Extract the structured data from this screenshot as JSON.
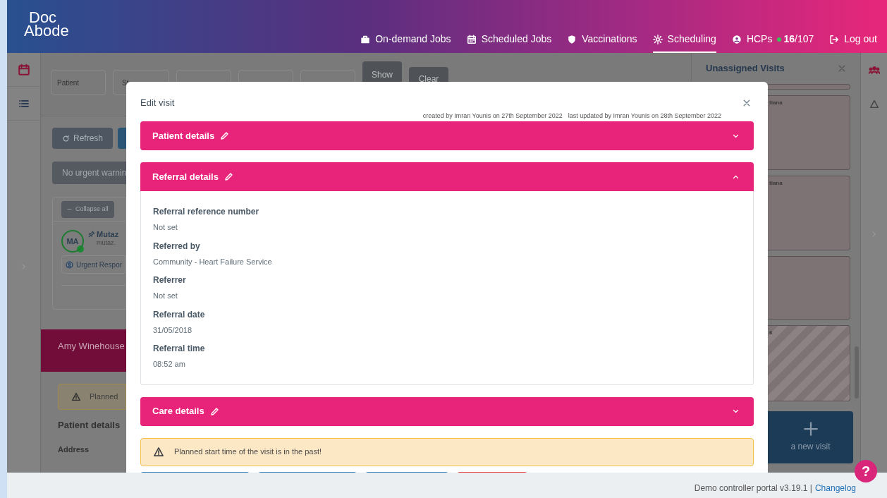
{
  "header": {
    "logo": [
      "Doc",
      "Abode"
    ],
    "nav": [
      {
        "kind": "link",
        "label": "On-demand Jobs",
        "selected": false
      },
      {
        "kind": "link",
        "label": "Scheduled Jobs",
        "selected": false
      },
      {
        "kind": "link",
        "label": "Vaccinations",
        "selected": false
      },
      {
        "kind": "link",
        "label": "Scheduling",
        "selected": true
      },
      {
        "kind": "count",
        "label": "HCPs",
        "count": "**16**/107",
        "selected": false
      },
      {
        "kind": "link",
        "label": "Log out",
        "selected": false
      }
    ]
  },
  "background": {
    "filters": {
      "patient_placeholder": "Patient",
      "field_2": "St",
      "show_button": "Show",
      "clear_button": "Clear"
    },
    "refresh_button": "Refresh",
    "warning_button": "No urgent warnin",
    "collapse_button": "Collapse all",
    "hcp": {
      "initials": "MA",
      "name": "Mutaz",
      "email": "mutaz.",
      "tag": "Urgent Respor"
    },
    "visit_banner": "Amy Winehouse",
    "planned_warning": "Planned",
    "patient_details": "Patient details",
    "address_label": "Address",
    "unassigned": {
      "title": "Unassigned Visits",
      "cards": [
        {
          "striped": false
        },
        {
          "text": "tiana",
          "striped": false
        },
        {
          "text": "tiana",
          "striped": false
        },
        {
          "striped": false
        },
        {
          "text": "6",
          "striped": true
        }
      ],
      "add_button": "a new visit"
    }
  },
  "modal": {
    "title": "Edit visit",
    "created": "created by Imran Younis on 27th September 2022",
    "updated": "last updated by Imran Younis on 28th September 2022",
    "sections": [
      {
        "title": "Patient details",
        "expanded": false
      },
      {
        "title": "Referral details",
        "expanded": true,
        "fields": [
          {
            "label": "Referral reference number",
            "value": "Not set"
          },
          {
            "label": "Referred by",
            "value": "Community - Heart Failure Service"
          },
          {
            "label": "Referrer",
            "value": "Not set"
          },
          {
            "label": "Referral date",
            "value": "31/05/2018"
          },
          {
            "label": "Referral time",
            "value": "08:52 am"
          }
        ]
      },
      {
        "title": "Care details",
        "expanded": false
      }
    ],
    "warning": "Planned start time of the visit is in the past!"
  },
  "footer": {
    "text": "Demo controller portal v3.19.1 |",
    "link": "Changelog",
    "help": "?"
  }
}
